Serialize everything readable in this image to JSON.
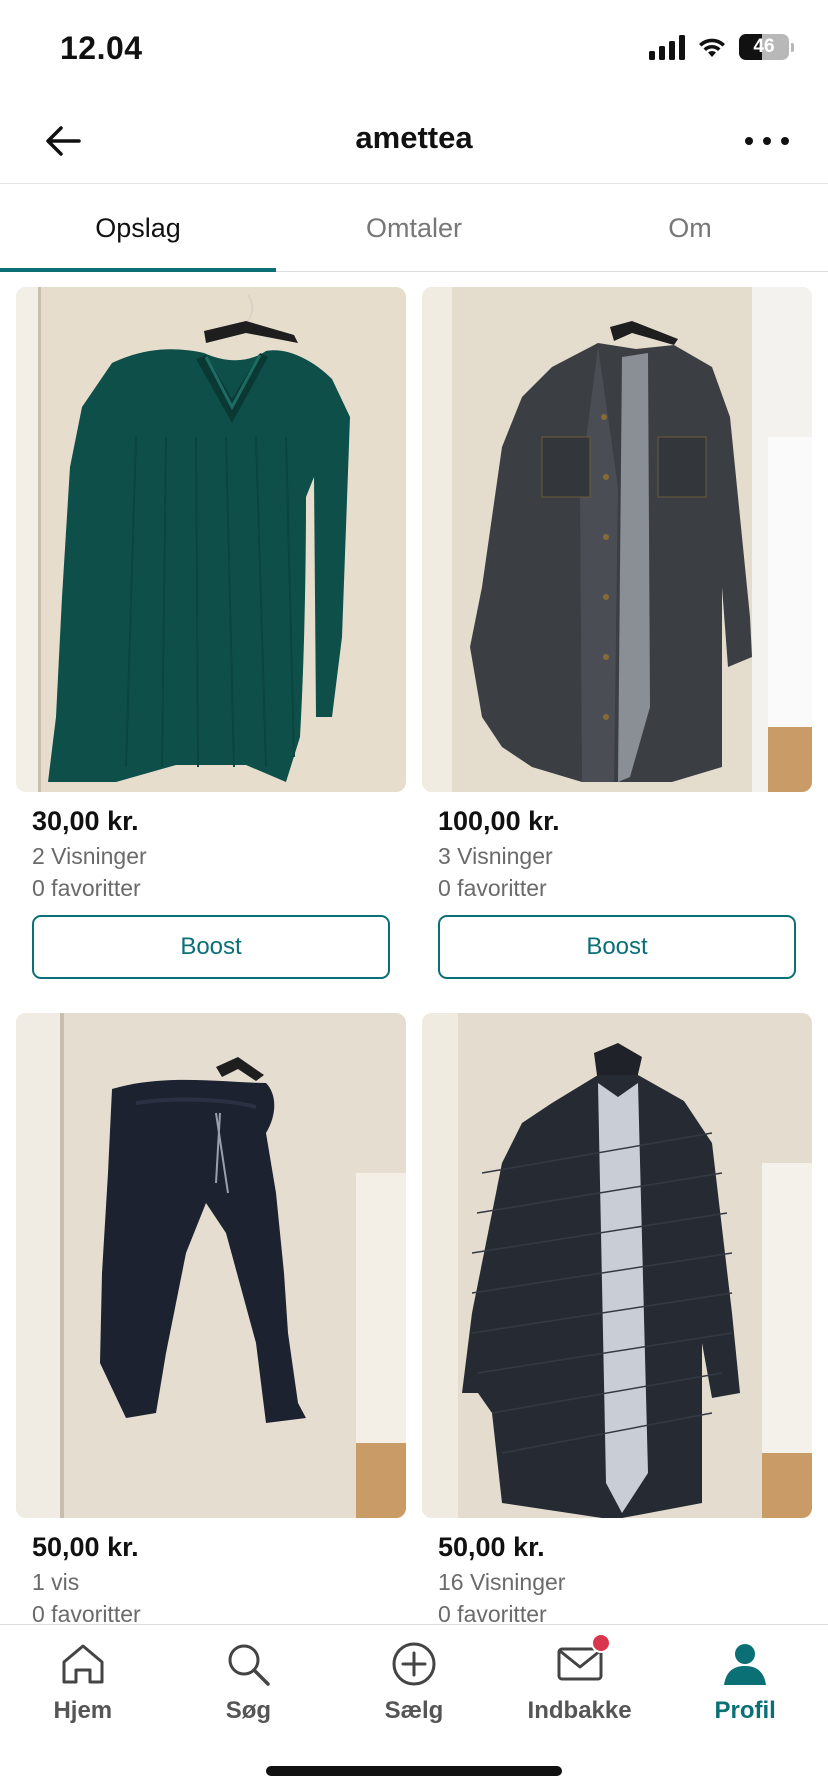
{
  "status_bar": {
    "time": "12.04",
    "battery_pct": "46",
    "battery_level": 0.46
  },
  "header": {
    "title": "amettea"
  },
  "tabs": [
    {
      "label": "Opslag",
      "active": true
    },
    {
      "label": "Omtaler",
      "active": false
    },
    {
      "label": "Om",
      "active": false
    }
  ],
  "listings": [
    {
      "price": "30,00 kr.",
      "views": "2 Visninger",
      "favorites": "0 favoritter",
      "boost_label": "Boost",
      "image": "teal-lace-top"
    },
    {
      "price": "100,00 kr.",
      "views": "3 Visninger",
      "favorites": "0 favoritter",
      "boost_label": "Boost",
      "image": "denim-jacket"
    },
    {
      "price": "50,00 kr.",
      "views": "1 vis",
      "favorites": "0 favoritter",
      "image": "navy-trousers"
    },
    {
      "price": "50,00 kr.",
      "views": "16 Visninger",
      "favorites": "0 favoritter",
      "image": "quilted-jacket"
    }
  ],
  "nav": [
    {
      "label": "Hjem",
      "icon": "home-icon"
    },
    {
      "label": "Søg",
      "icon": "search-icon"
    },
    {
      "label": "Sælg",
      "icon": "plus-circle-icon"
    },
    {
      "label": "Indbakke",
      "icon": "mail-icon",
      "badge": true
    },
    {
      "label": "Profil",
      "icon": "profile-icon",
      "active": true
    }
  ],
  "colors": {
    "accent": "#0b7075",
    "badge": "#d9364d",
    "text": "#111111",
    "muted": "#6a6a6a"
  }
}
